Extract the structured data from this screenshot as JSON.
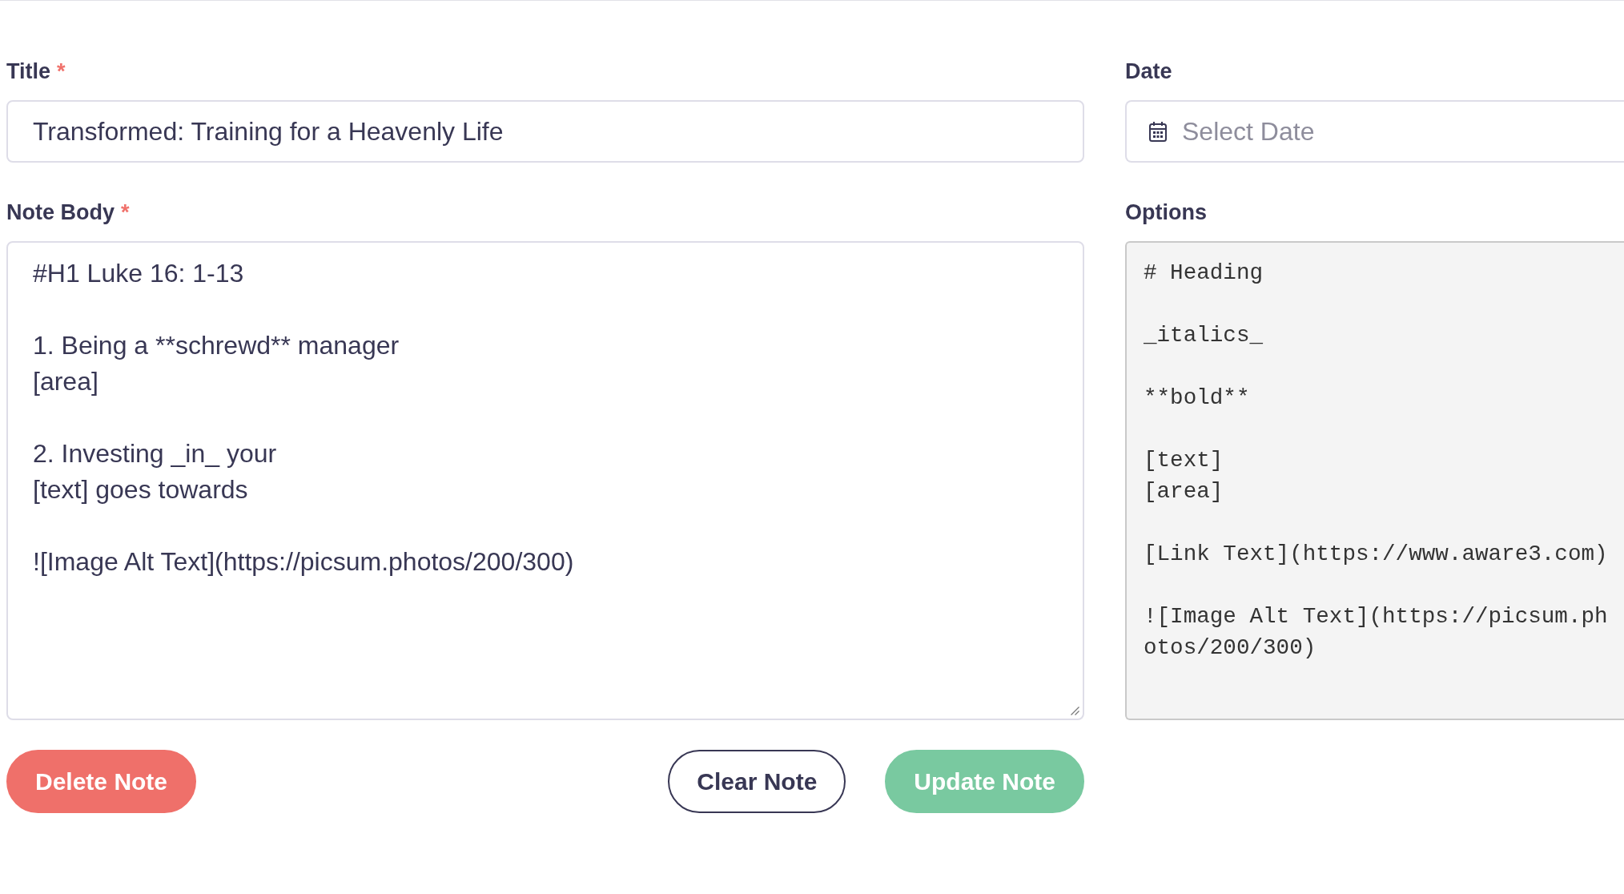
{
  "form": {
    "title": {
      "label": "Title",
      "required_mark": "*",
      "value": "Transformed: Training for a Heavenly Life"
    },
    "date": {
      "label": "Date",
      "placeholder": "Select Date"
    },
    "note_body": {
      "label": "Note Body",
      "required_mark": "*",
      "value": "#H1 Luke 16: 1-13\n\n1. Being a **schrewd** manager\n[area]\n\n2. Investing _in_ your\n[text] goes towards\n\n![Image Alt Text](https://picsum.photos/200/300)"
    },
    "options": {
      "label": "Options",
      "groups": [
        [
          "# Heading"
        ],
        [
          "_italics_"
        ],
        [
          "**bold**"
        ],
        [
          "[text]",
          "[area]"
        ],
        [
          "[Link Text](https://www.aware3.com)"
        ],
        [
          "![Image Alt Text](https://picsum.photos/200/300)"
        ]
      ]
    }
  },
  "buttons": [
    {
      "label": "Delete Note",
      "kind": "danger"
    },
    {
      "label": "Clear Note",
      "kind": "outline"
    },
    {
      "label": "Update Note",
      "kind": "success"
    }
  ]
}
